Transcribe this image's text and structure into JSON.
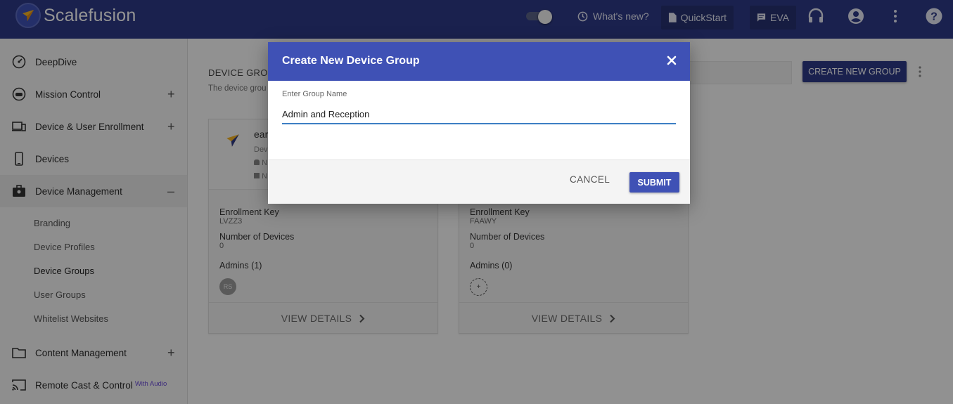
{
  "topbar": {
    "brand": "Scalefusion",
    "whats_new": "What's new?",
    "quickstart": "QuickStart",
    "eva": "EVA",
    "background_color": "#2e3a87"
  },
  "sidebar": {
    "items": [
      {
        "label": "DeepDive",
        "icon": "dashboard-gauge-icon"
      },
      {
        "label": "Mission Control",
        "icon": "robot-icon",
        "expand": "+"
      },
      {
        "label": "Device & User Enrollment",
        "icon": "devices-icon",
        "expand": "+"
      },
      {
        "label": "Devices",
        "icon": "smartphone-icon"
      },
      {
        "label": "Device Management",
        "icon": "briefcase-icon",
        "expand": "–"
      },
      {
        "label": "Content Management",
        "icon": "folder-icon",
        "expand": "+"
      },
      {
        "label": "Remote Cast & Control",
        "icon": "cast-icon",
        "badge": "With Audio"
      }
    ],
    "sub_items": [
      "Branding",
      "Device Profiles",
      "Device Groups",
      "User Groups",
      "Whitelist Websites"
    ]
  },
  "main": {
    "title": "DEVICE GROU",
    "subtitle": "The device grou",
    "create_button": "CREATE NEW GROUP",
    "cards": [
      {
        "name": "ear",
        "desc": "Dev",
        "os1": "N",
        "os2": "N",
        "enrollment_key_label": "Enrollment Key",
        "enrollment_key": "LVZZ3",
        "devices_label": "Number of Devices",
        "devices": "0",
        "admins_label": "Admins (1)",
        "admin_initials": "RS",
        "view_details": "VIEW DETAILS"
      },
      {
        "enrollment_key_label": "Enrollment Key",
        "enrollment_key": "FAAWY",
        "devices_label": "Number of Devices",
        "devices": "0",
        "admins_label": "Admins (0)",
        "add_admin": "+",
        "view_details": "VIEW DETAILS"
      }
    ]
  },
  "dialog": {
    "title": "Create New Device Group",
    "field_label": "Enter Group Name",
    "field_value": "Admin and Reception",
    "cancel": "CANCEL",
    "submit": "SUBMIT",
    "accent_color": "#3f51b5"
  }
}
